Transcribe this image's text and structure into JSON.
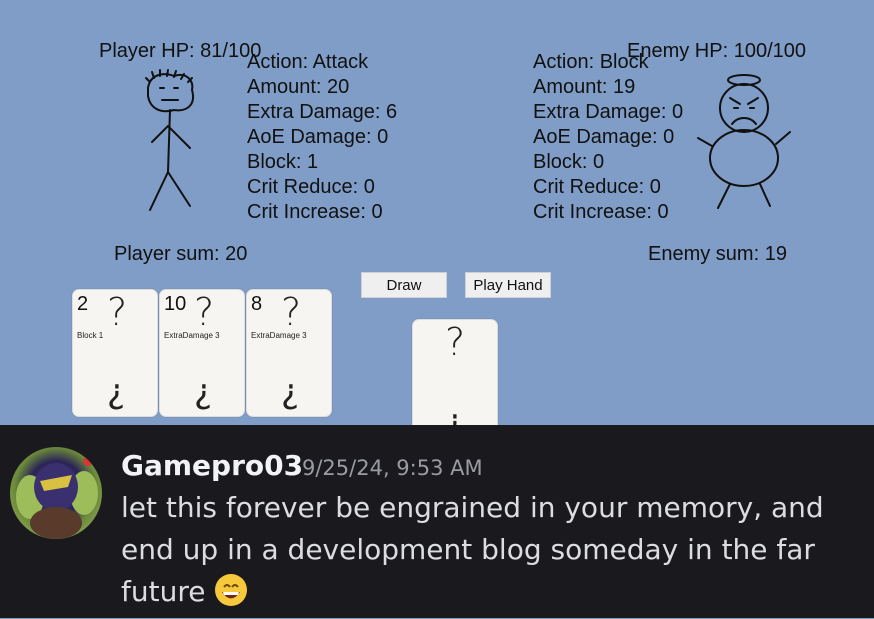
{
  "player": {
    "hp_text": "Player HP: 81/100",
    "action": "Action: Attack",
    "amount": "Amount: 20",
    "extra_damage": "Extra Damage: 6",
    "aoe_damage": "AoE Damage: 0",
    "block": "Block: 1",
    "crit_reduce": "Crit Reduce: 0",
    "crit_increase": "Crit Increase: 0",
    "sum_text": "Player sum: 20"
  },
  "enemy": {
    "hp_text": "Enemy HP: 100/100",
    "action": "Action: Block",
    "amount": "Amount: 19",
    "extra_damage": "Extra Damage: 0",
    "aoe_damage": "AoE Damage: 0",
    "block": "Block: 0",
    "crit_reduce": "Crit Reduce: 0",
    "crit_increase": "Crit Increase: 0",
    "sum_text": "Enemy sum: 19"
  },
  "buttons": {
    "draw_label": "Draw",
    "play_hand_label": "Play Hand"
  },
  "hand": [
    {
      "value": "2",
      "effect": "Block 1",
      "top_symbol": "?",
      "bottom_symbol": "¿"
    },
    {
      "value": "10",
      "effect": "ExtraDamage 3",
      "top_symbol": "?",
      "bottom_symbol": "¿"
    },
    {
      "value": "8",
      "effect": "ExtraDamage 3",
      "top_symbol": "?",
      "bottom_symbol": "¿"
    }
  ],
  "deck_card": {
    "top_symbol": "?",
    "bottom_symbol": "¿"
  },
  "message": {
    "username": "Gamepro03",
    "timestamp": "9/25/24, 9:53 AM",
    "text": "let this forever be engrained in your memory, and end up in a development blog someday in the far future",
    "emoji": "grinning-face-emoji"
  }
}
